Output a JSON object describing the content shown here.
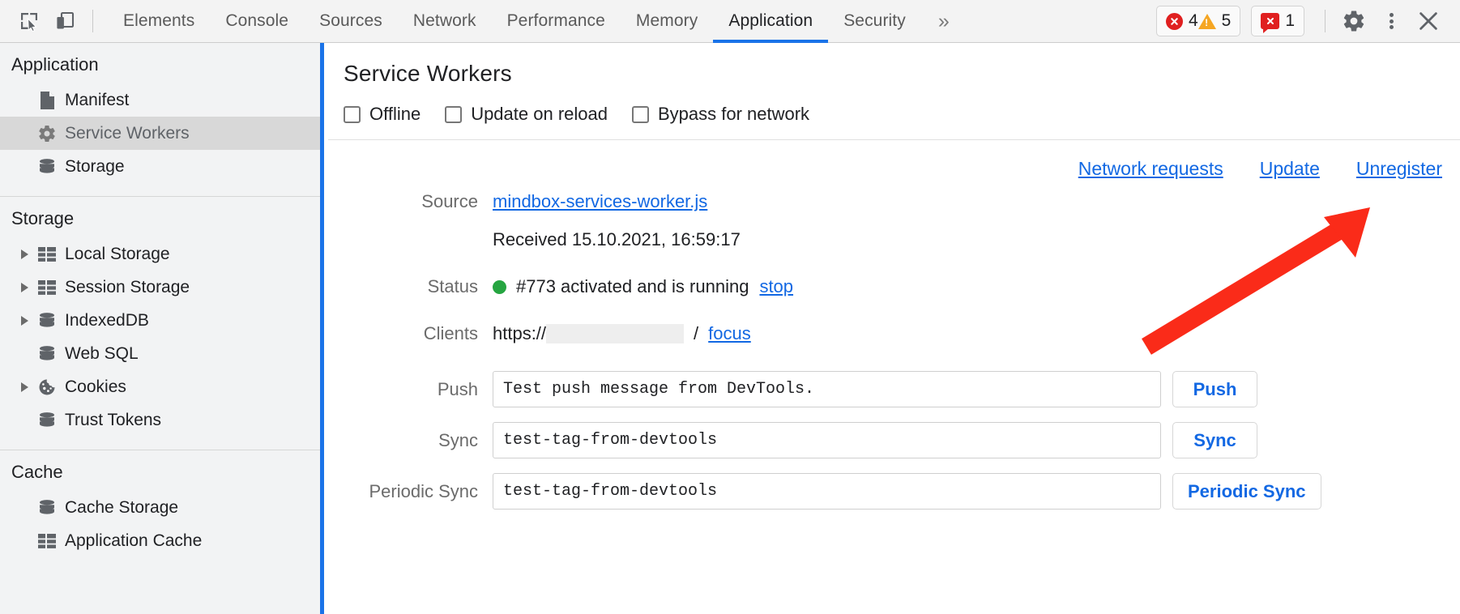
{
  "toolbar": {
    "inspect_icon": "inspect-element-icon",
    "device_icon": "device-toolbar-icon",
    "tabs": [
      {
        "label": "Elements",
        "selected": false
      },
      {
        "label": "Console",
        "selected": false
      },
      {
        "label": "Sources",
        "selected": false
      },
      {
        "label": "Network",
        "selected": false
      },
      {
        "label": "Performance",
        "selected": false
      },
      {
        "label": "Memory",
        "selected": false
      },
      {
        "label": "Application",
        "selected": true
      },
      {
        "label": "Security",
        "selected": false
      }
    ],
    "overflow_label": "»",
    "error_count": "4",
    "warning_count": "5",
    "issue_count": "1",
    "settings_icon": "gear-icon",
    "more_icon": "kebab-menu-icon",
    "close_icon": "close-icon",
    "accent_color": "#1a73e8",
    "error_color": "#e02020",
    "warning_color": "#f5a623"
  },
  "sidebar": {
    "groups": [
      {
        "title": "Application",
        "items": [
          {
            "label": "Manifest",
            "icon": "document-icon",
            "expandable": false,
            "selected": false
          },
          {
            "label": "Service Workers",
            "icon": "gear-icon",
            "expandable": false,
            "selected": true
          },
          {
            "label": "Storage",
            "icon": "database-icon",
            "expandable": false,
            "selected": false
          }
        ]
      },
      {
        "title": "Storage",
        "items": [
          {
            "label": "Local Storage",
            "icon": "table-icon",
            "expandable": true,
            "selected": false
          },
          {
            "label": "Session Storage",
            "icon": "table-icon",
            "expandable": true,
            "selected": false
          },
          {
            "label": "IndexedDB",
            "icon": "database-icon",
            "expandable": true,
            "selected": false
          },
          {
            "label": "Web SQL",
            "icon": "database-icon",
            "expandable": false,
            "selected": false
          },
          {
            "label": "Cookies",
            "icon": "cookie-icon",
            "expandable": true,
            "selected": false
          },
          {
            "label": "Trust Tokens",
            "icon": "database-icon",
            "expandable": false,
            "selected": false
          }
        ]
      },
      {
        "title": "Cache",
        "items": [
          {
            "label": "Cache Storage",
            "icon": "database-icon",
            "expandable": false,
            "selected": false
          },
          {
            "label": "Application Cache",
            "icon": "table-icon",
            "expandable": false,
            "selected": false
          }
        ]
      }
    ]
  },
  "main": {
    "title": "Service Workers",
    "checkboxes": [
      {
        "label": "Offline",
        "checked": false
      },
      {
        "label": "Update on reload",
        "checked": false
      },
      {
        "label": "Bypass for network",
        "checked": false
      }
    ],
    "actions": [
      {
        "label": "Network requests"
      },
      {
        "label": "Update"
      },
      {
        "label": "Unregister"
      }
    ],
    "details": {
      "source_label": "Source",
      "source_value": "mindbox-services-worker.js",
      "received_line": "Received 15.10.2021, 16:59:17",
      "status_label": "Status",
      "status_value": "#773 activated and is running",
      "status_action": "stop",
      "status_color": "#26a541",
      "clients_label": "Clients",
      "clients_scheme": "https://",
      "clients_path": "/",
      "clients_action": "focus"
    },
    "fields": [
      {
        "label": "Push",
        "value": "Test push message from DevTools.",
        "button": "Push"
      },
      {
        "label": "Sync",
        "value": "test-tag-from-devtools",
        "button": "Sync"
      },
      {
        "label": "Periodic Sync",
        "value": "test-tag-from-devtools",
        "button": "Periodic Sync"
      }
    ]
  },
  "annotation": {
    "arrow_color": "#fa2b19",
    "arrow_points_at": "Unregister"
  }
}
